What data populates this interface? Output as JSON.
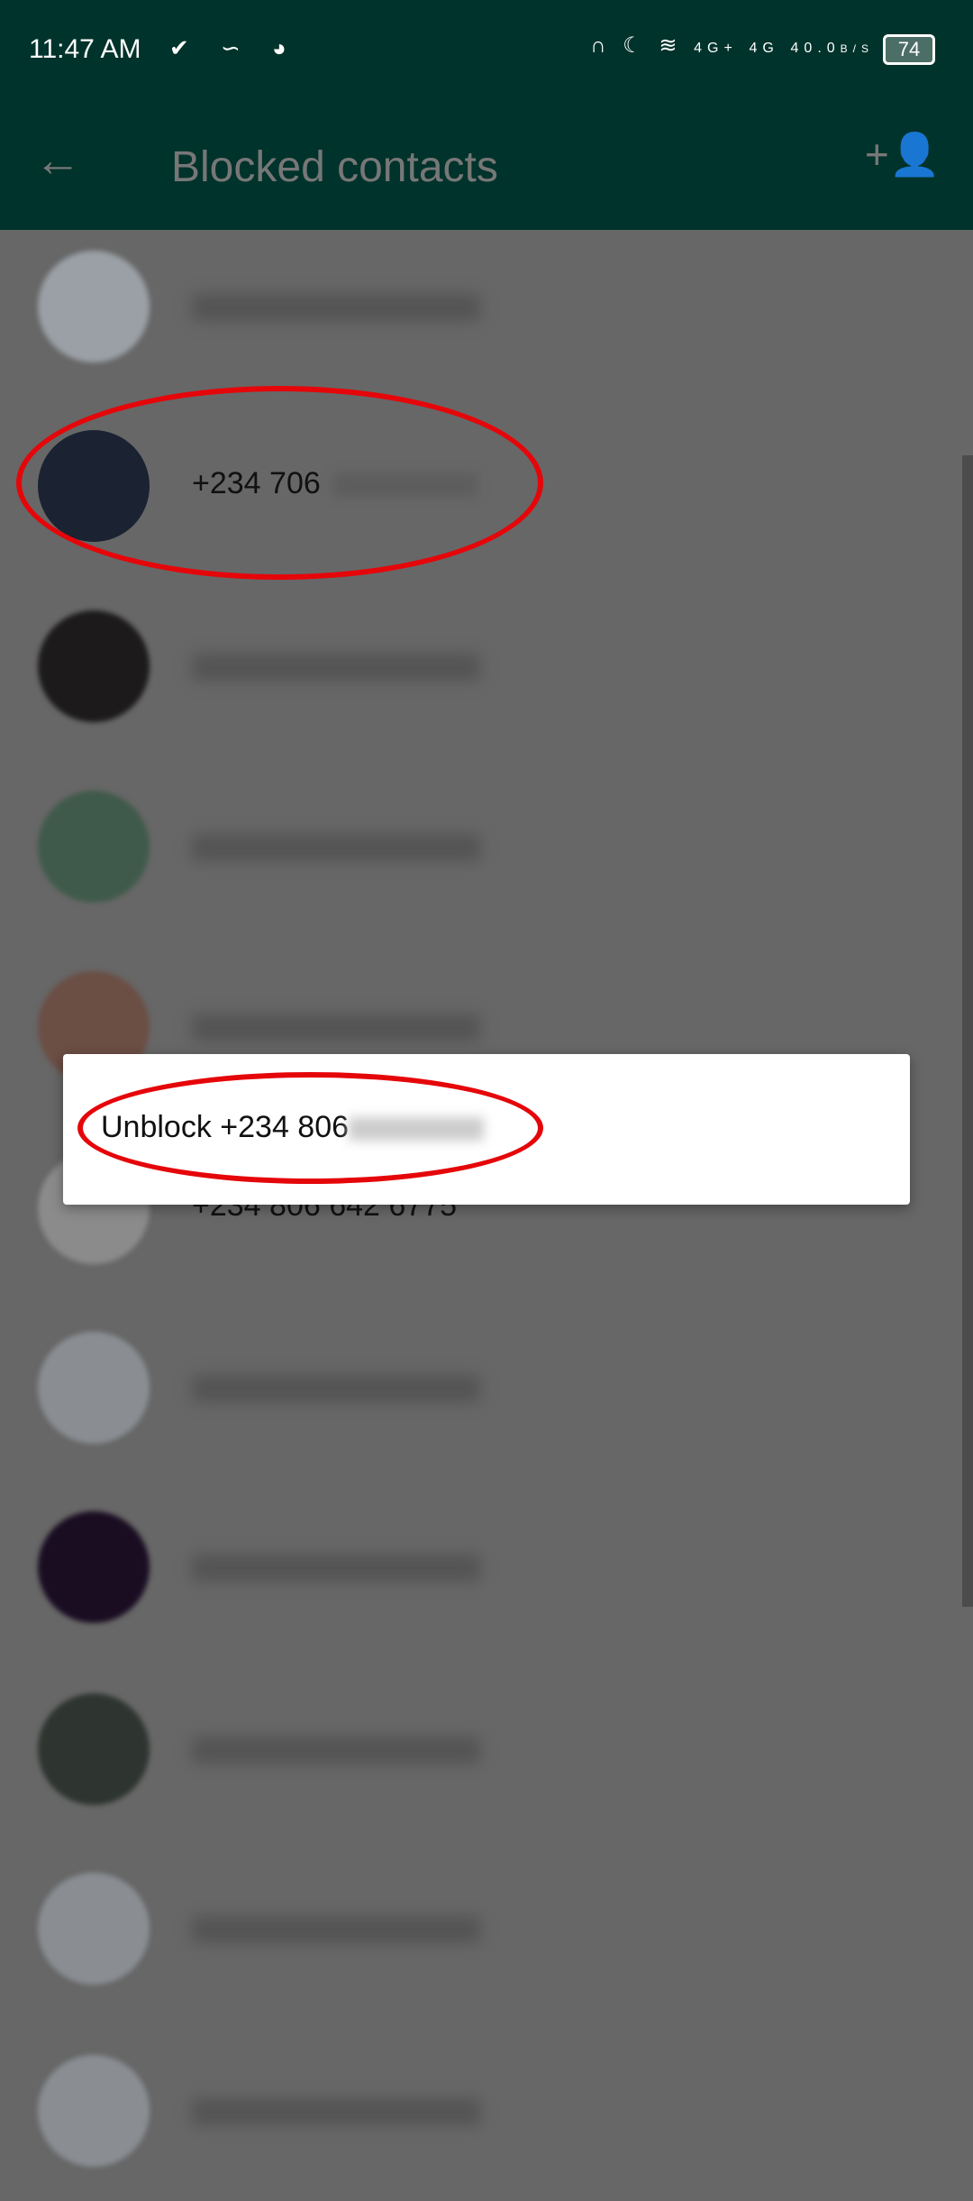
{
  "status_bar": {
    "time": "11:47 AM",
    "network_speed": "40.0",
    "network_speed_unit": "B/S",
    "battery": "74",
    "signal_labels": [
      "4G+",
      "4G"
    ]
  },
  "toolbar": {
    "title": "Blocked contacts",
    "back_icon": "arrow-left-icon",
    "add_icon": "add-contact-icon"
  },
  "contacts": [
    {
      "number": "",
      "avatar": "#9aa0a6"
    },
    {
      "number_visible": "+234 706",
      "avatar": "#1b2232"
    },
    {
      "number": "",
      "avatar": "#1c1a1a"
    },
    {
      "number": "",
      "avatar": "#3f5a4a"
    },
    {
      "number": "",
      "avatar": "#6b4e44"
    },
    {
      "number": "+234 806 642 6775",
      "avatar": "#8b8b8b"
    },
    {
      "number": "",
      "avatar": "#8a8e93"
    },
    {
      "number": "",
      "avatar": "#1a0d22"
    },
    {
      "number": "",
      "avatar": "#2e3530"
    },
    {
      "number": "",
      "avatar": "#8a8e93"
    },
    {
      "number": "",
      "avatar": "#8a8e93"
    }
  ],
  "popup": {
    "unblock_label": "Unblock +234 806"
  },
  "colors": {
    "header": "#00332b",
    "highlight": "#e5060a",
    "overlay": "#676767"
  }
}
